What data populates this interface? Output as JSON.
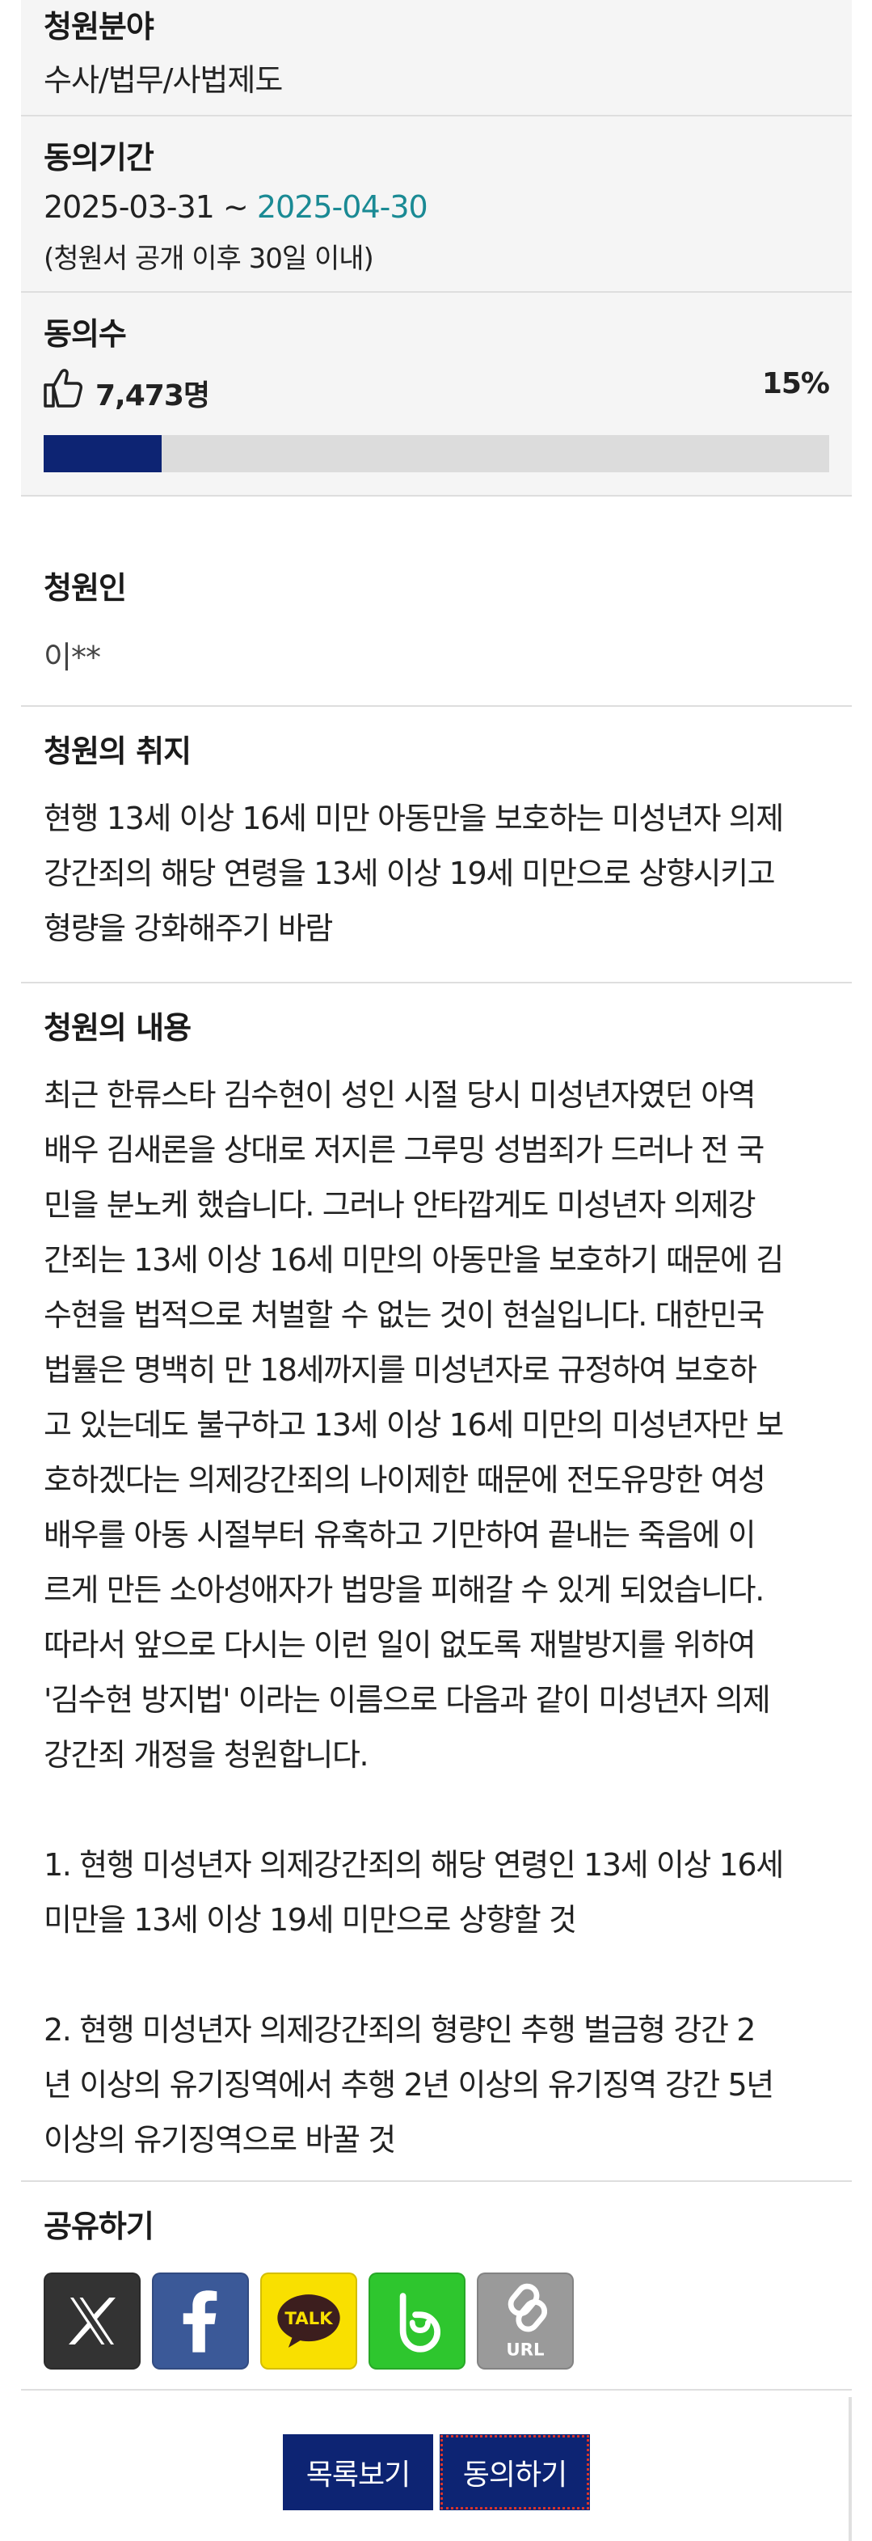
{
  "field": {
    "label": "청원분야",
    "value": "수사/법무/사법제도"
  },
  "period": {
    "label": "동의기간",
    "start": "2025-03-31 ~ ",
    "end": "2025-04-30",
    "note": "(청원서 공개 이후 30일 이내)"
  },
  "agree_count": {
    "label": "동의수",
    "count": "7,473명",
    "percent_label": "15%",
    "progress_fraction": 0.15,
    "icon": "thumbs-up-icon"
  },
  "petitioner": {
    "label": "청원인",
    "name": "이**"
  },
  "purpose": {
    "label": "청원의 취지",
    "lines": [
      "현행 13세 이상 16세 미만 아동만을 보호하는 미성년자 의제",
      "강간죄의 해당 연령을 13세 이상 19세 미만으로 상향시키고",
      "형량을 강화해주기 바람"
    ]
  },
  "content": {
    "label": "청원의 내용",
    "paragraph1": [
      "최근 한류스타 김수현이 성인 시절 당시 미성년자였던 아역",
      "배우 김새론을 상대로 저지른 그루밍 성범죄가 드러나 전 국",
      "민을 분노케 했습니다. 그러나 안타깝게도 미성년자 의제강",
      "간죄는 13세 이상 16세 미만의 아동만을 보호하기 때문에 김",
      "수현을 법적으로 처벌할 수 없는 것이 현실입니다. 대한민국",
      "법률은 명백히 만 18세까지를 미성년자로 규정하여 보호하",
      "고 있는데도 불구하고 13세 이상 16세 미만의 미성년자만 보",
      "호하겠다는 의제강간죄의 나이제한 때문에 전도유망한 여성",
      "배우를 아동 시절부터 유혹하고 기만하여 끝내는 죽음에 이",
      "르게 만든 소아성애자가 법망을 피해갈 수 있게 되었습니다.",
      "따라서 앞으로 다시는 이런 일이 없도록 재발방지를 위하여",
      "'김수현 방지법' 이라는 이름으로 다음과 같이 미성년자 의제",
      "강간죄 개정을 청원합니다."
    ],
    "item1": [
      "1. 현행 미성년자 의제강간죄의 해당 연령인 13세 이상 16세",
      "미만을 13세 이상 19세 미만으로 상향할 것"
    ],
    "item2": [
      "2. 현행 미성년자 의제강간죄의 형량인 추행 벌금형 강간 2",
      "년 이상의 유기징역에서 추행 2년 이상의 유기징역 강간 5년",
      "이상의 유기징역으로 바꿀 것"
    ]
  },
  "share": {
    "label": "공유하기",
    "buttons": [
      {
        "name": "x",
        "icon": "x-logo-icon",
        "color": "#333333"
      },
      {
        "name": "facebook",
        "icon": "facebook-logo-icon",
        "color": "#3b5998"
      },
      {
        "name": "kakaotalk",
        "icon": "kakaotalk-logo-icon",
        "text": "TALK",
        "color": "#f9e000"
      },
      {
        "name": "band",
        "icon": "band-logo-icon",
        "color": "#2ec62e"
      },
      {
        "name": "url",
        "icon": "link-icon",
        "text": "URL",
        "color": "#9a9a9a"
      }
    ]
  },
  "footer": {
    "list_label": "목록보기",
    "agree_label": "동의하기"
  },
  "colors": {
    "primary": "#0d2473",
    "accent": "#1a8a94",
    "progress_track": "#dcdcdc"
  }
}
